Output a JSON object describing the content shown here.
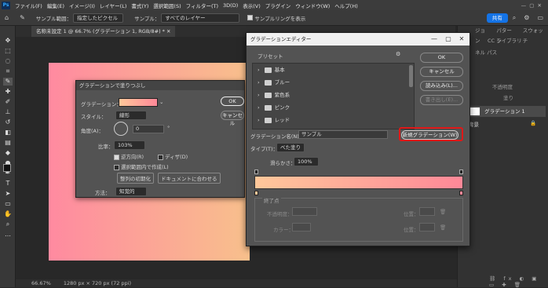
{
  "menubar": {
    "logo": "Ps",
    "items": [
      "ファイル(F)",
      "編集(E)",
      "イメージ(I)",
      "レイヤー(L)",
      "書式(Y)",
      "選択範囲(S)",
      "フィルター(T)",
      "3D(D)",
      "表示(V)",
      "プラグイン",
      "ウィンドウ(W)",
      "ヘルプ(H)"
    ]
  },
  "optbar": {
    "sample_range_label": "サンプル範囲：",
    "sample_range_value": "指定したピクセル",
    "sample_label": "サンプル：",
    "sample_value": "すべてのレイヤー",
    "show_ring_label": "サンプルリングを表示",
    "share_label": "共有"
  },
  "document": {
    "tab": "名称未設定 1 @ 66.7% (グラデーション 1, RGB/8#) *",
    "zoom": "66.67%",
    "size": "1280 px × 720 px (72 ppi)"
  },
  "rightpanel": {
    "tabs": [
      "ジョン",
      "パターン",
      "スウォッチ"
    ],
    "sub": "CC ライブラリ",
    "sub2": "ネル  パス",
    "mode_label": "不透明度",
    "fill_label": "塗り",
    "layer_name": "グラデーション 1",
    "bg_label": "背景"
  },
  "filldlg": {
    "title": "グラデーションで塗りつぶし",
    "gradient_label": "グラデーション：",
    "style_label": "スタイル：",
    "style_value": "線形",
    "angle_label": "角度(A)：",
    "angle_value": "0",
    "degree": "°",
    "scale_label": "比率：",
    "scale_value": "103%",
    "reverse_label": "逆方向(R)",
    "dither_label": "ディザ(D)",
    "align_label": "選択範囲内で作成(L)",
    "reset_align": "整列の初期化",
    "fit_doc": "ドキュメントに合わせる",
    "method_label": "方法：",
    "method_value": "知覚的",
    "ok": "OK",
    "cancel": "キャンセル"
  },
  "graddlg": {
    "title": "グラデーションエディター",
    "presets_label": "プリセット",
    "preset_folders": [
      "基本",
      "ブルー",
      "紫色系",
      "ピンク",
      "レッド"
    ],
    "ok": "OK",
    "cancel": "キャンセル",
    "load": "読み込み(L)...",
    "save": "書き出し(E)...",
    "name_label": "グラデーション名(N)：",
    "name_value": "サンプル",
    "new_button": "新規グラデーション(W)",
    "type_label": "タイプ(T)：",
    "type_value": "べた塗り",
    "smooth_label": "滑らかさ：",
    "smooth_value": "100%",
    "stops_label": "終了点",
    "opacity_label": "不透明度：",
    "location_label": "位置：",
    "delete_label": "削除(D)",
    "color_label": "カラー：",
    "location2_label": "位置："
  },
  "colors": {
    "grad_start": "#ffc89a",
    "grad_end": "#ff8898",
    "highlight": "#e01818"
  }
}
